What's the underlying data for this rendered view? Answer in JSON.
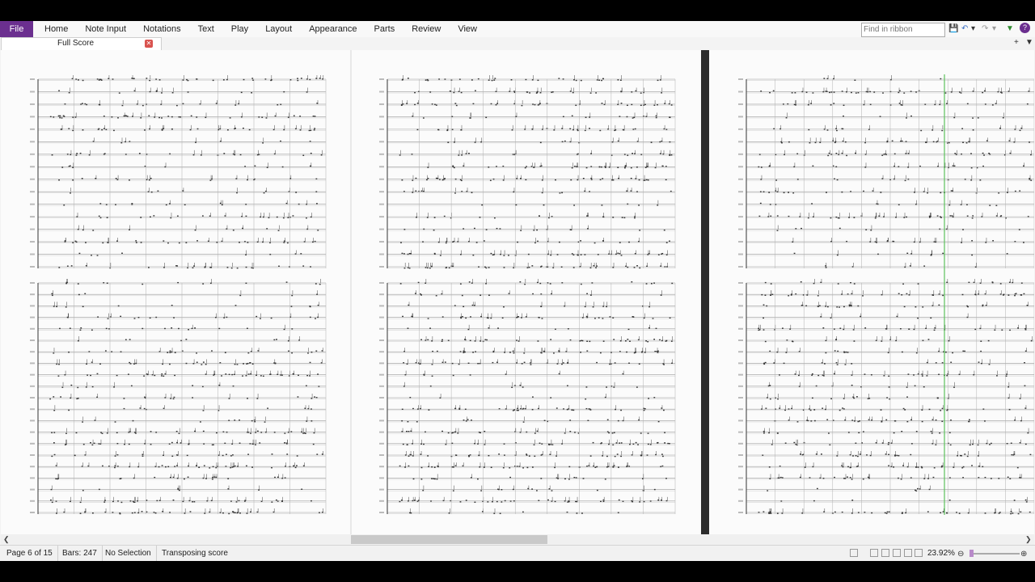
{
  "ribbon": {
    "file_label": "File",
    "tabs": [
      "Home",
      "Note Input",
      "Notations",
      "Text",
      "Play",
      "Layout",
      "Appearance",
      "Parts",
      "Review",
      "View"
    ],
    "search_placeholder": "Find in ribbon"
  },
  "document": {
    "tab_label": "Full Score"
  },
  "status": {
    "page": "Page 6 of 15",
    "bars": "Bars: 247",
    "selection": "No Selection",
    "score_mode": "Transposing score",
    "zoom": "23.92%"
  }
}
